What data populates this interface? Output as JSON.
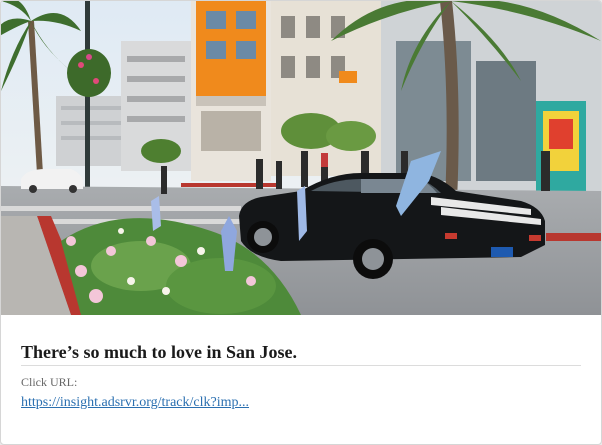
{
  "ad": {
    "image_icon": "street-photo",
    "headline": "There’s so much to love in San Jose.",
    "click_label": "Click URL:",
    "click_url": "https://insight.adsrvr.org/track/clk?imp..."
  },
  "colors": {
    "headline": "#1a1a1a",
    "label": "#666666",
    "link": "#2a6fb0",
    "border": "#dcdcdc"
  }
}
